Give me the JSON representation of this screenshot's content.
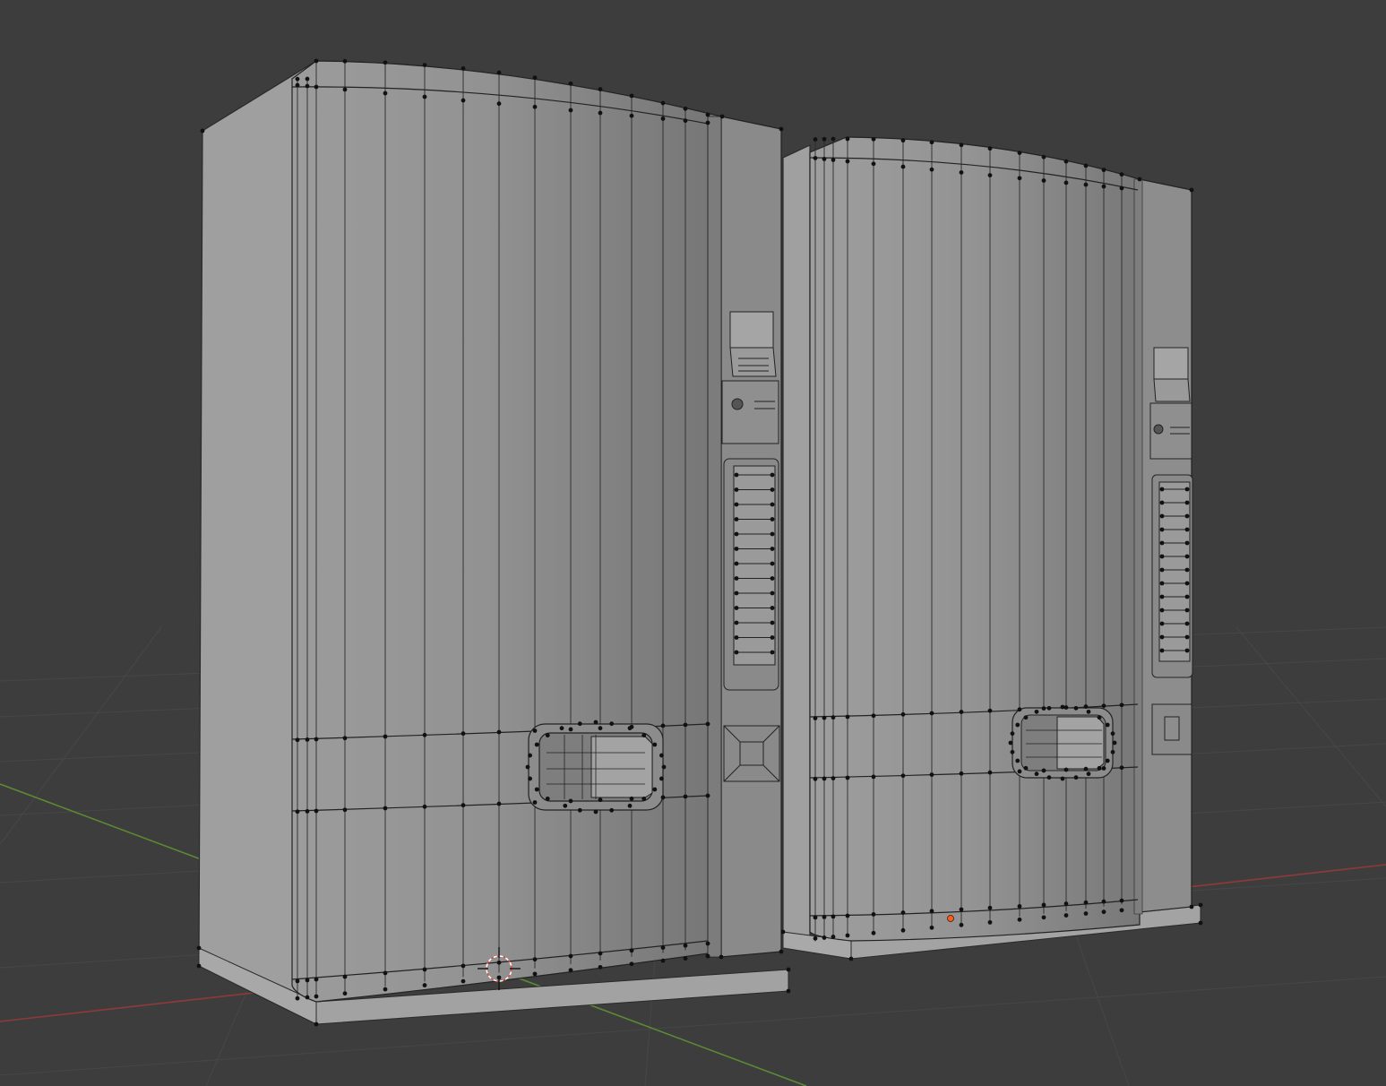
{
  "viewport": {
    "background": "#3d3d3d",
    "grid_color": "#484848",
    "x_axis_color": "#9a3b3b",
    "y_axis_color": "#5f8a36",
    "mesh_face_light": "#9b9b9b",
    "mesh_face_mid": "#8e8e8e",
    "mesh_face_dark": "#787878",
    "edge_color": "#262626",
    "vertex_color": "#111111",
    "origin_color": "#ff5a1f"
  },
  "scene": {
    "objects": [
      {
        "name": "vending-machine-left",
        "mode": "edit"
      },
      {
        "name": "vending-machine-right",
        "mode": "edit"
      }
    ],
    "icons": {
      "cursor": "3d-cursor-icon",
      "origin": "object-origin-icon"
    }
  }
}
